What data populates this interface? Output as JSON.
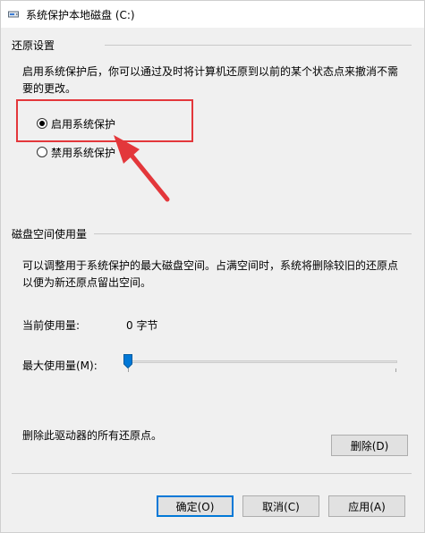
{
  "window": {
    "title": "系统保护本地磁盘 (C:)"
  },
  "restore": {
    "section_title": "还原设置",
    "description_line1": "启用系统保护后，你可以通过及时将计算机还原到以前的某个状态点来撤消不需",
    "description_line2": "要的更改。",
    "option_enable": "启用系统保护",
    "option_disable": "禁用系统保护",
    "selected": "enable"
  },
  "disk": {
    "section_title": "磁盘空间使用量",
    "description_line1": "可以调整用于系统保护的最大磁盘空间。占满空间时，系统将删除较旧的还原点",
    "description_line2": "以便为新还原点留出空间。",
    "current_usage_label": "当前使用量:",
    "current_usage_value": "0 字节",
    "max_usage_label": "最大使用量(M):",
    "max_usage_fraction": 0
  },
  "delete": {
    "text": "删除此驱动器的所有还原点。",
    "button_label": "删除(D)"
  },
  "footer": {
    "ok_label": "确定(O)",
    "cancel_label": "取消(C)",
    "apply_label": "应用(A)"
  },
  "annotation": {
    "color": "#e3373b"
  }
}
